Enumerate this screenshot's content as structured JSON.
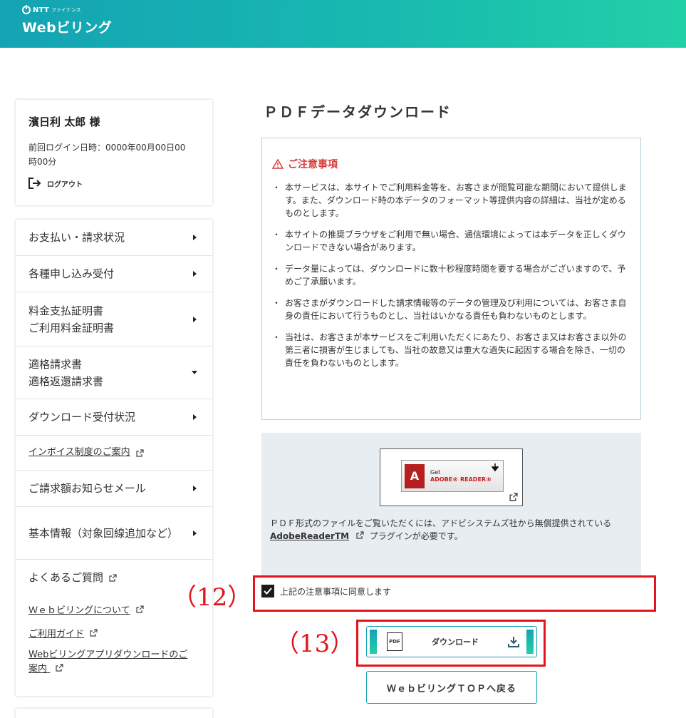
{
  "header": {
    "brand_ntt": "NTT",
    "brand_finance": "ファイナンス",
    "app_name": "Webビリング"
  },
  "user": {
    "name": "濱日利 太郎 様",
    "last_login": "前回ログイン日時：0000年00月00日00時00分",
    "logout_label": "ログアウト"
  },
  "menu": {
    "items": [
      {
        "label": "お支払い・請求状況"
      },
      {
        "label": "各種申し込み受付"
      },
      {
        "label_line1": "料金支払証明書",
        "label_line2": "ご利用料金証明書"
      },
      {
        "label_line1": "適格請求書",
        "label_line2": "適格返還請求書"
      },
      {
        "label": "ダウンロード受付状況"
      },
      {
        "label": "インボイス制度のご案内"
      },
      {
        "label": "ご請求額お知らせメール"
      },
      {
        "label": "基本情報（対象回線追加など）"
      },
      {
        "label": "よくあるご質問"
      }
    ],
    "sublinks": [
      {
        "label": "Ｗｅｂビリングについて"
      },
      {
        "label": "ご利用ガイド"
      },
      {
        "label": "Webビリングアプリダウンロードのご案内"
      }
    ]
  },
  "main": {
    "title": "ＰＤＦデータダウンロード",
    "notice_title": "ご注意事項",
    "notices": [
      "本サービスは、本サイトでご利用料金等を、お客さまが閲覧可能な期間において提供します。また、ダウンロード時の本データのフォーマット等提供内容の詳細は、当社が定めるものとします。",
      "本サイトの推奨ブラウザをご利用で無い場合、通信環境によっては本データを正しくダウンロードできない場合があります。",
      "データ量によっては、ダウンロードに数十秒程度時間を要する場合がございますので、予めご了承願います。",
      "お客さまがダウンロードした請求情報等のデータの管理及び利用については、お客さま自身の責任において行うものとし、当社はいかなる責任も負わないものとします。",
      "当社は、お客さまが本サービスをご利用いただくにあたり、お客さま又はお客さま以外の第三者に損害が生じましても、当社の故意又は重大な過失に起因する場合を除き、一切の責任を負わないものとします。"
    ],
    "adobe": {
      "get": "Get",
      "reader": "ADOBE® READER®",
      "desc": "ＰＤＦ形式のファイルをご覧いただくには、アドビシステムズ社から無償提供されている",
      "link": "AdobeReaderTM",
      "desc_tail": "プラグインが必要です。"
    },
    "agree_label": "上記の注意事項に同意します",
    "agree_checked": true,
    "download_label": "ダウンロード",
    "pdf_icon_text": "PDF",
    "top_button_label": "ＷｅｂビリングＴＯＰへ戻る"
  },
  "annotations": {
    "label_12": "（12）",
    "label_13": "（13）",
    "color": "#e3141c"
  }
}
